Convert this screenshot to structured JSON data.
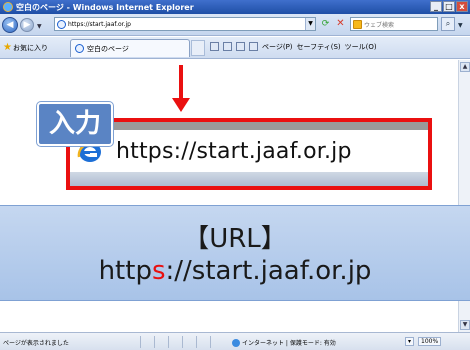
{
  "window": {
    "title": "空白のページ - Windows Internet Explorer",
    "min_label": "_",
    "max_label": "□",
    "close_label": "x"
  },
  "addressbar": {
    "url": "https://start.jaaf.or.jp",
    "search_placeholder": "ウェブ検索"
  },
  "tabbar": {
    "favorites_label": "お気に入り",
    "tab_label": "空白のページ",
    "page_menu": "ページ(P)",
    "safety_menu": "セーフティ(S)",
    "tools_menu": "ツール(O)"
  },
  "annotation": {
    "input_label": "入力",
    "zoom_url": "https://start.jaaf.or.jp",
    "caption_title": "【URL】",
    "caption_url_before": "http",
    "caption_url_highlight": "s",
    "caption_url_after": "://start.jaaf.or.jp",
    "highlight_color": "#e81010",
    "frame_color": "#ea1010"
  },
  "statusbar": {
    "status_text": "ページが表示されました",
    "zone_text": "インターネット | 保護モード: 有効",
    "zoom_text": "100%"
  }
}
